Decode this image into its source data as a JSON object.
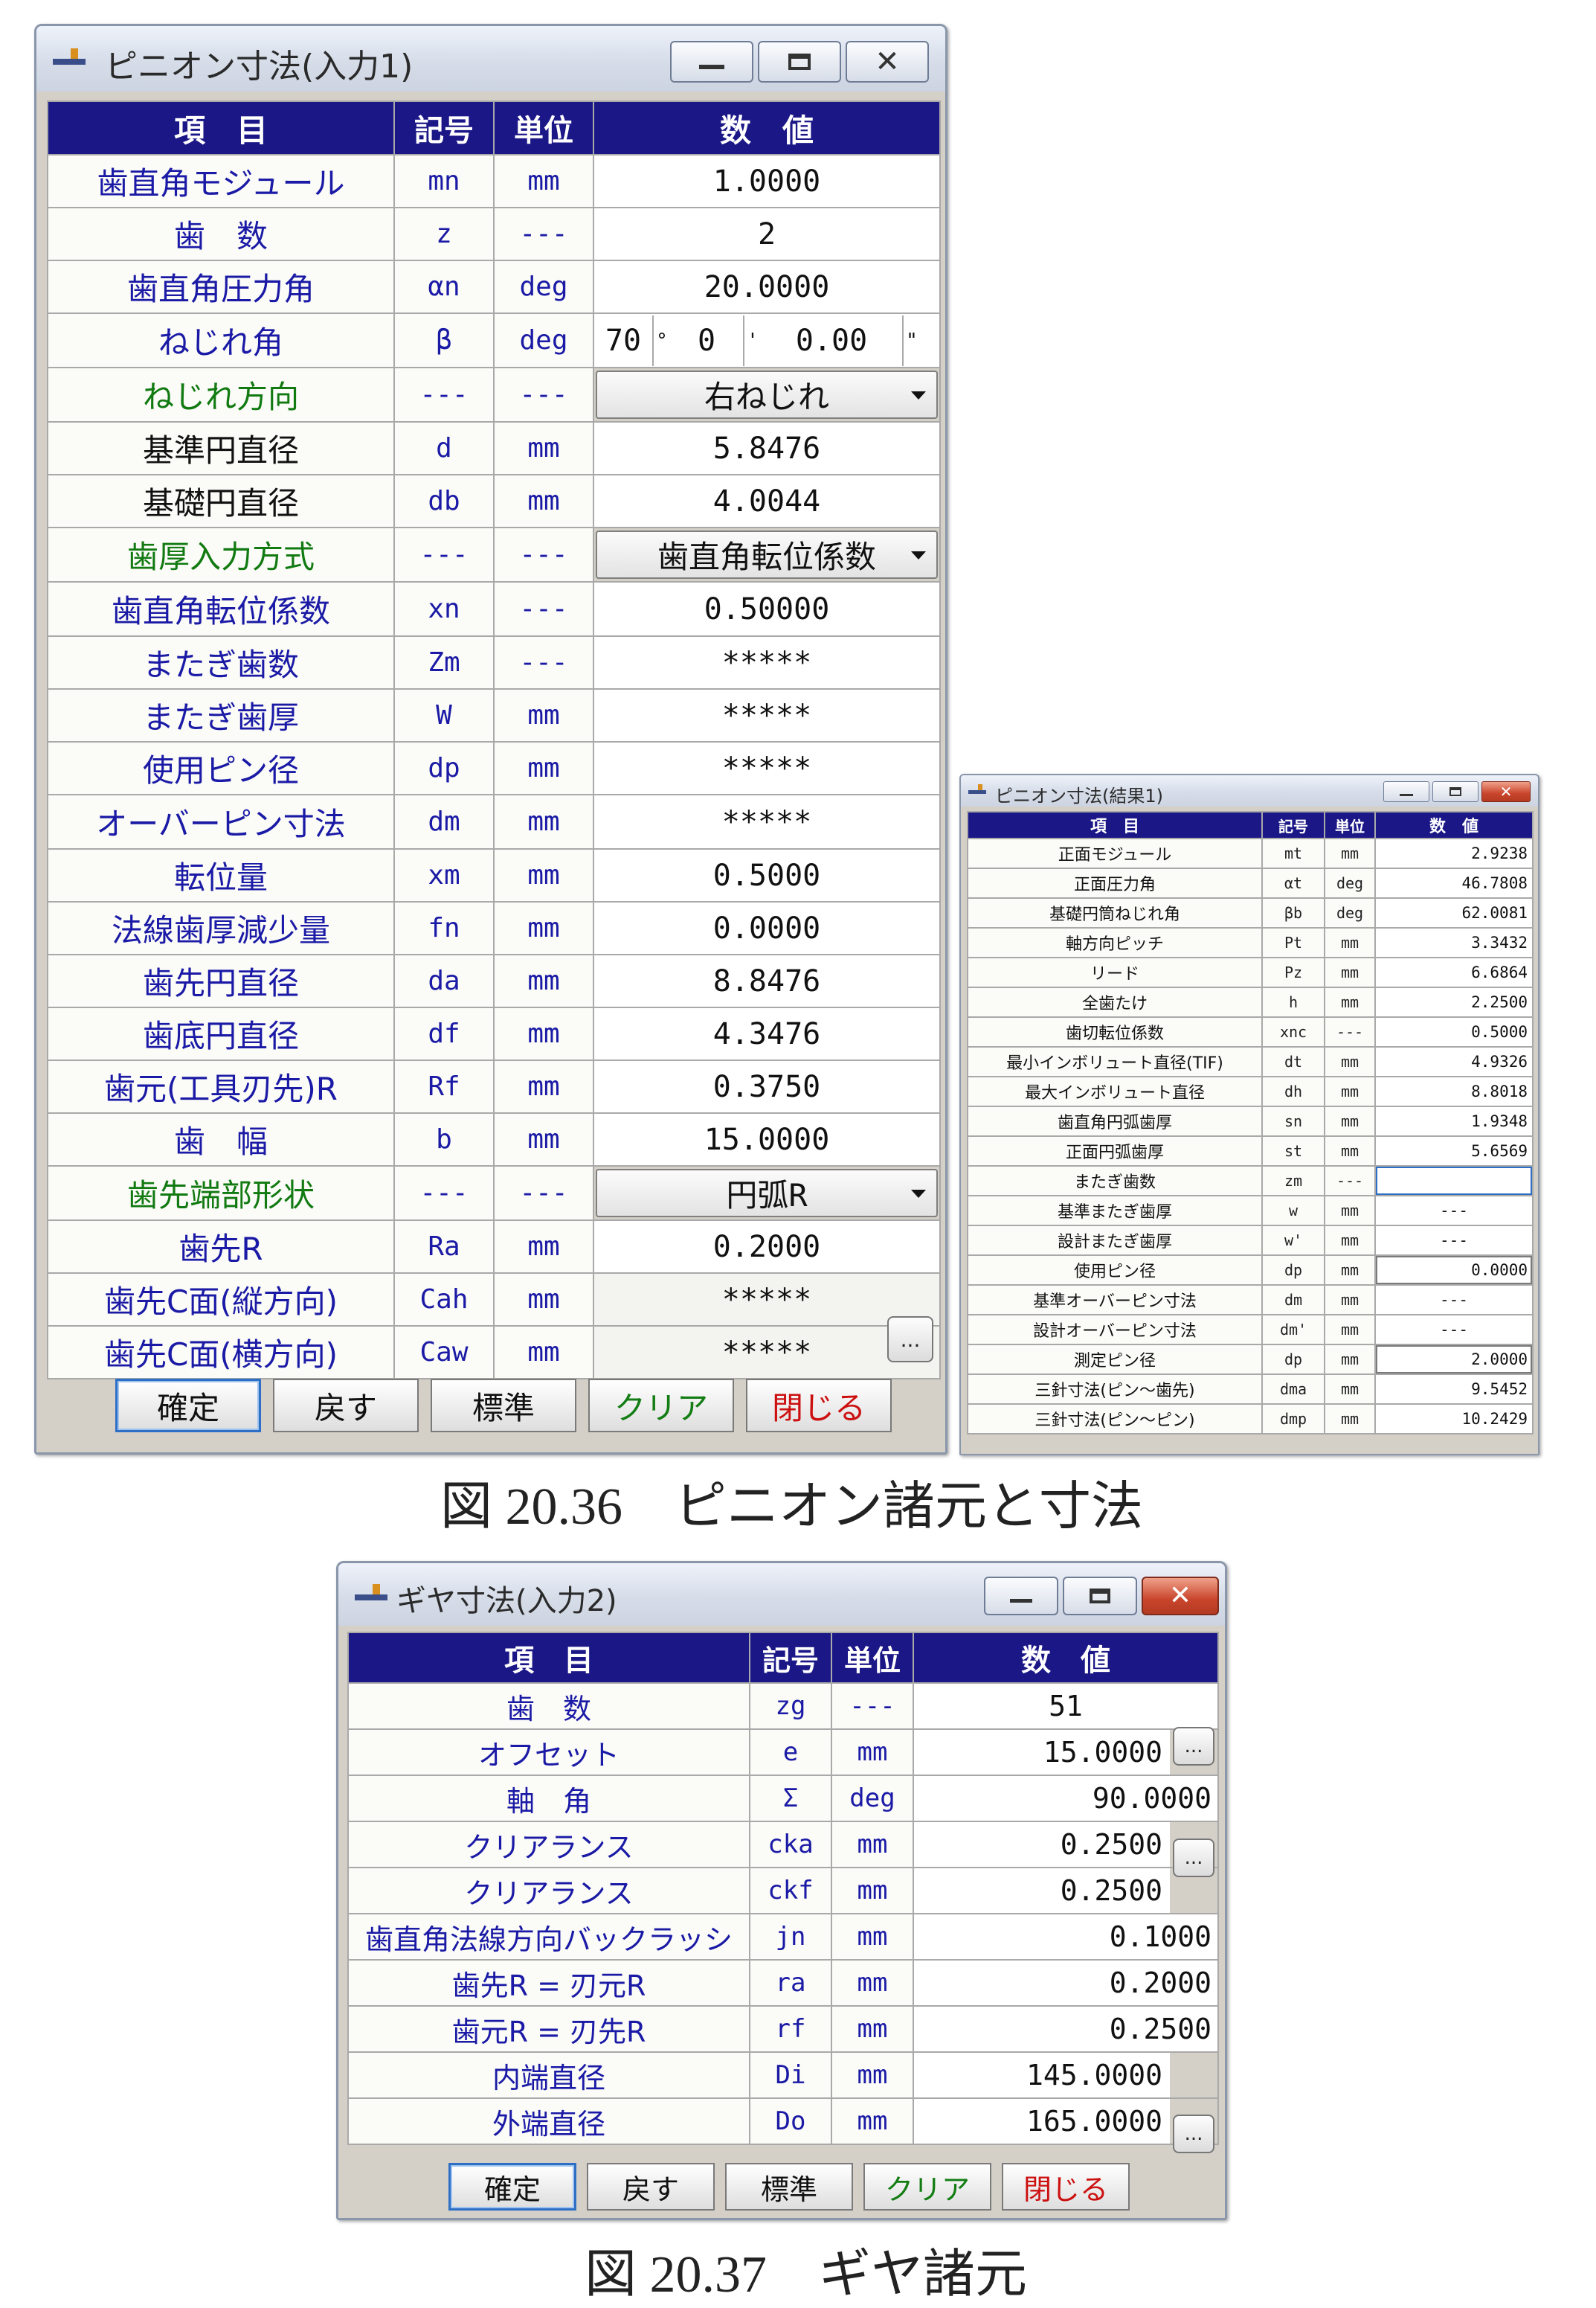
{
  "colors": {
    "header_bg": "#1b1787",
    "label_blue": "#1a1aa6",
    "label_green": "#117a11",
    "clear_green": "#137d13",
    "close_red": "#cc1010"
  },
  "win1": {
    "title": "ピニオン寸法(入力1)",
    "headers": {
      "item": "項　目",
      "symbol": "記号",
      "unit": "単位",
      "value": "数　値"
    },
    "rows": [
      {
        "label": "歯直角モジュール",
        "color": "blue",
        "sym": "mn",
        "unit": "mm",
        "value": "1.0000"
      },
      {
        "label": "歯　数",
        "color": "blue",
        "sym": "z",
        "unit": "---",
        "value": "2"
      },
      {
        "label": "歯直角圧力角",
        "color": "blue",
        "sym": "αn",
        "unit": "deg",
        "value": "20.0000"
      },
      {
        "label": "ねじれ角",
        "color": "blue",
        "sym": "β",
        "unit": "deg",
        "dms": [
          "70",
          "°",
          "0",
          "'",
          "0.00",
          "\""
        ]
      },
      {
        "label": "ねじれ方向",
        "color": "green",
        "sym": "---",
        "unit": "---",
        "combo": "右ねじれ"
      },
      {
        "label": "基準円直径",
        "color": "black",
        "sym": "d",
        "unit": "mm",
        "value": "5.8476"
      },
      {
        "label": "基礎円直径",
        "color": "black",
        "sym": "db",
        "unit": "mm",
        "value": "4.0044"
      },
      {
        "label": "歯厚入力方式",
        "color": "green",
        "sym": "---",
        "unit": "---",
        "combo": "歯直角転位係数"
      },
      {
        "label": "歯直角転位係数",
        "color": "blue",
        "sym": "xn",
        "unit": "---",
        "value": "0.50000"
      },
      {
        "label": "またぎ歯数",
        "color": "blue",
        "sym": "Zm",
        "unit": "---",
        "value": "*****"
      },
      {
        "label": "またぎ歯厚",
        "color": "blue",
        "sym": "W",
        "unit": "mm",
        "value": "*****"
      },
      {
        "label": "使用ピン径",
        "color": "blue",
        "sym": "dp",
        "unit": "mm",
        "value": "*****"
      },
      {
        "label": "オーバーピン寸法",
        "color": "blue",
        "sym": "dm",
        "unit": "mm",
        "value": "*****"
      },
      {
        "label": "転位量",
        "color": "blue",
        "sym": "xm",
        "unit": "mm",
        "value": "0.5000"
      },
      {
        "label": "法線歯厚減少量",
        "color": "blue",
        "sym": "fn",
        "unit": "mm",
        "value": "0.0000"
      },
      {
        "label": "歯先円直径",
        "color": "blue",
        "sym": "da",
        "unit": "mm",
        "value": "8.8476"
      },
      {
        "label": "歯底円直径",
        "color": "blue",
        "sym": "df",
        "unit": "mm",
        "value": "4.3476"
      },
      {
        "label": "歯元(工具刃先)R",
        "color": "blue",
        "sym": "Rf",
        "unit": "mm",
        "value": "0.3750"
      },
      {
        "label": "歯　幅",
        "color": "blue",
        "sym": "b",
        "unit": "mm",
        "value": "15.0000"
      },
      {
        "label": "歯先端部形状",
        "color": "green",
        "sym": "---",
        "unit": "---",
        "combo": "円弧R"
      },
      {
        "label": "歯先R",
        "color": "blue",
        "sym": "Ra",
        "unit": "mm",
        "value": "0.2000"
      },
      {
        "label": "歯先C面(縦方向)",
        "color": "blue",
        "sym": "Cah",
        "unit": "mm",
        "value": "*****"
      },
      {
        "label": "歯先C面(横方向)",
        "color": "blue",
        "sym": "Caw",
        "unit": "mm",
        "value": "*****"
      }
    ],
    "dots_label": "...",
    "buttons": {
      "ok": "確定",
      "back": "戻す",
      "std": "標準",
      "clear": "クリア",
      "close": "閉じる"
    }
  },
  "win2": {
    "title": "ピニオン寸法(結果1)",
    "headers": {
      "item": "項　目",
      "symbol": "記号",
      "unit": "単位",
      "value": "数　値"
    },
    "rows": [
      {
        "label": "正面モジュール",
        "sym": "mt",
        "unit": "mm",
        "value": "2.9238"
      },
      {
        "label": "正面圧力角",
        "sym": "αt",
        "unit": "deg",
        "value": "46.7808"
      },
      {
        "label": "基礎円筒ねじれ角",
        "sym": "βb",
        "unit": "deg",
        "value": "62.0081"
      },
      {
        "label": "軸方向ピッチ",
        "sym": "Pt",
        "unit": "mm",
        "value": "3.3432"
      },
      {
        "label": "リード",
        "sym": "Pz",
        "unit": "mm",
        "value": "6.6864"
      },
      {
        "label": "全歯たけ",
        "sym": "h",
        "unit": "mm",
        "value": "2.2500"
      },
      {
        "label": "歯切転位係数",
        "sym": "xnc",
        "unit": "---",
        "value": "0.5000"
      },
      {
        "label": "最小インボリュート直径(TIF)",
        "sym": "dt",
        "unit": "mm",
        "value": "4.9326"
      },
      {
        "label": "最大インボリュート直径",
        "sym": "dh",
        "unit": "mm",
        "value": "8.8018"
      },
      {
        "label": "歯直角円弧歯厚",
        "sym": "sn",
        "unit": "mm",
        "value": "1.9348"
      },
      {
        "label": "正面円弧歯厚",
        "sym": "st",
        "unit": "mm",
        "value": "5.6569"
      },
      {
        "label": "またぎ歯数",
        "sym": "zm",
        "unit": "---",
        "value": ""
      },
      {
        "label": "基準またぎ歯厚",
        "sym": "w",
        "unit": "mm",
        "value": "---"
      },
      {
        "label": "設計またぎ歯厚",
        "sym": "w'",
        "unit": "mm",
        "value": "---"
      },
      {
        "label": "使用ピン径",
        "sym": "dp",
        "unit": "mm",
        "value": "0.0000"
      },
      {
        "label": "基準オーバーピン寸法",
        "sym": "dm",
        "unit": "mm",
        "value": "---"
      },
      {
        "label": "設計オーバーピン寸法",
        "sym": "dm'",
        "unit": "mm",
        "value": "---"
      },
      {
        "label": "測定ピン径",
        "sym": "dp",
        "unit": "mm",
        "value": "2.0000"
      },
      {
        "label": "三針寸法(ピン～歯先)",
        "sym": "dma",
        "unit": "mm",
        "value": "9.5452"
      },
      {
        "label": "三針寸法(ピン～ピン)",
        "sym": "dmp",
        "unit": "mm",
        "value": "10.2429"
      }
    ]
  },
  "win3": {
    "title": "ギヤ寸法(入力2)",
    "headers": {
      "item": "項　目",
      "symbol": "記号",
      "unit": "単位",
      "value": "数　値"
    },
    "rows": [
      {
        "label": "歯　数",
        "sym": "zg",
        "unit": "---",
        "value": "51"
      },
      {
        "label": "オフセット",
        "sym": "e",
        "unit": "mm",
        "value": "15.0000"
      },
      {
        "label": "軸　角",
        "sym": "Σ",
        "unit": "deg",
        "value": "90.0000"
      },
      {
        "label": "クリアランス",
        "sym": "cka",
        "unit": "mm",
        "value": "0.2500"
      },
      {
        "label": "クリアランス",
        "sym": "ckf",
        "unit": "mm",
        "value": "0.2500"
      },
      {
        "label": "歯直角法線方向バックラッシ",
        "sym": "jn",
        "unit": "mm",
        "value": "0.1000"
      },
      {
        "label": "歯先R = 刃元R",
        "sym": "ra",
        "unit": "mm",
        "value": "0.2000"
      },
      {
        "label": "歯元R = 刃先R",
        "sym": "rf",
        "unit": "mm",
        "value": "0.2500"
      },
      {
        "label": "内端直径",
        "sym": "Di",
        "unit": "mm",
        "value": "145.0000"
      },
      {
        "label": "外端直径",
        "sym": "Do",
        "unit": "mm",
        "value": "165.0000"
      }
    ],
    "dots_label": "...",
    "buttons": {
      "ok": "確定",
      "back": "戻す",
      "std": "標準",
      "clear": "クリア",
      "close": "閉じる"
    }
  },
  "captions": {
    "fig1": "図 20.36　ピニオン諸元と寸法",
    "fig2": "図 20.37　ギヤ諸元"
  }
}
